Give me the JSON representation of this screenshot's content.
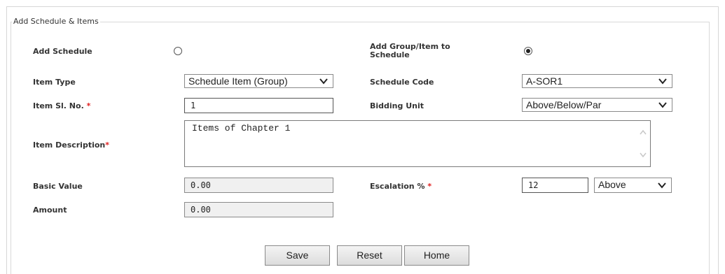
{
  "panel": {
    "title": "Add Schedule & Items"
  },
  "form": {
    "add_schedule": {
      "label": "Add Schedule",
      "selected": false
    },
    "add_group": {
      "label": "Add Group/Item to Schedule",
      "selected": true
    },
    "item_type": {
      "label": "Item Type",
      "value": "Schedule Item (Group)"
    },
    "schedule_code": {
      "label": "Schedule Code",
      "value": "A-SOR1"
    },
    "item_sl_no": {
      "label": "Item Sl. No.",
      "required_mark": "*",
      "value": "1"
    },
    "bidding_unit": {
      "label": "Bidding Unit",
      "value": "Above/Below/Par"
    },
    "item_description": {
      "label": "Item Description",
      "required_mark": "*",
      "value": "Items of Chapter 1"
    },
    "basic_value": {
      "label": "Basic Value",
      "value": "0.00"
    },
    "escalation": {
      "label": "Escalation %",
      "required_mark": "*",
      "value": "12",
      "direction": "Above"
    },
    "amount": {
      "label": "Amount",
      "value": "0.00"
    }
  },
  "buttons": {
    "save": "Save",
    "reset": "Reset",
    "home": "Home"
  },
  "icons": {
    "dropdown": "chevron-down-icon",
    "scroll_up": "scroll-up-icon",
    "scroll_down": "scroll-down-icon"
  },
  "colors": {
    "required": "#e02020",
    "readonly_bg": "#f0f0f0"
  }
}
